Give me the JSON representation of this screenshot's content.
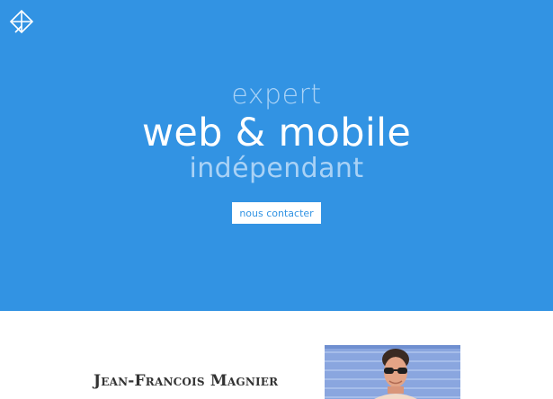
{
  "hero": {
    "line1": "expert",
    "line2": "web & mobile",
    "line3": "indépendant",
    "cta_label": "nous contacter",
    "background": "#3293e3",
    "accent_text": "#a9d2f6"
  },
  "about": {
    "name": "Jean-Francois Magnier"
  },
  "icons": {
    "logo": "logo-icon",
    "portrait": "portrait-photo"
  }
}
